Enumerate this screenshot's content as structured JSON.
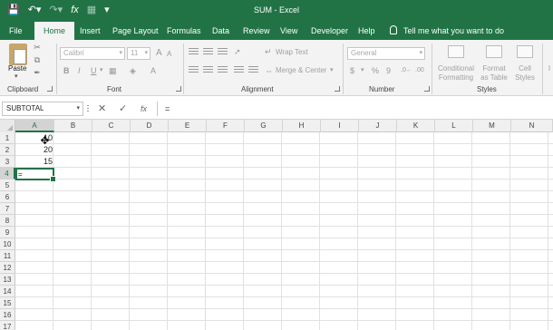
{
  "title_bar": {
    "doc_title": "SUM  -  Excel"
  },
  "tabs": [
    {
      "label": "File",
      "active": false
    },
    {
      "label": "Home",
      "active": true
    },
    {
      "label": "Insert",
      "active": false
    },
    {
      "label": "Page Layout",
      "active": false
    },
    {
      "label": "Formulas",
      "active": false
    },
    {
      "label": "Data",
      "active": false
    },
    {
      "label": "Review",
      "active": false
    },
    {
      "label": "View",
      "active": false
    },
    {
      "label": "Developer",
      "active": false
    },
    {
      "label": "Help",
      "active": false
    }
  ],
  "tell_me": "Tell me what you want to do",
  "ribbon": {
    "clipboard": {
      "label": "Clipboard",
      "paste": "Paste"
    },
    "font": {
      "label": "Font",
      "font_name": "Calibri",
      "font_size": "11",
      "bold": "B",
      "italic": "I",
      "underline": "U",
      "grow": "A",
      "shrink": "A"
    },
    "alignment": {
      "label": "Alignment",
      "wrap_text": "Wrap Text",
      "merge_center": "Merge & Center"
    },
    "number": {
      "label": "Number",
      "format": "General",
      "currency": "$",
      "percent": "%",
      "comma": "9"
    },
    "styles": {
      "label": "Styles",
      "conditional": "Conditional Formatting",
      "format_table": "Format as Table",
      "cell_styles": "Cell Styles",
      "cut_off": "I"
    }
  },
  "formula_bar": {
    "name_box": "SUBTOTAL",
    "cancel": "✕",
    "enter": "✓",
    "fx": "fx",
    "content": "="
  },
  "grid": {
    "columns": [
      "A",
      "B",
      "C",
      "D",
      "E",
      "F",
      "G",
      "H",
      "I",
      "J",
      "K",
      "L",
      "M",
      "N"
    ],
    "selected_column": "A",
    "rows": [
      "1",
      "2",
      "3",
      "4",
      "5",
      "6",
      "7",
      "8",
      "9",
      "10",
      "11",
      "12",
      "13",
      "14",
      "15",
      "16",
      "17"
    ],
    "selected_row": "4",
    "cells": {
      "A1": "10",
      "A2": "20",
      "A3": "15",
      "A4": "="
    }
  }
}
